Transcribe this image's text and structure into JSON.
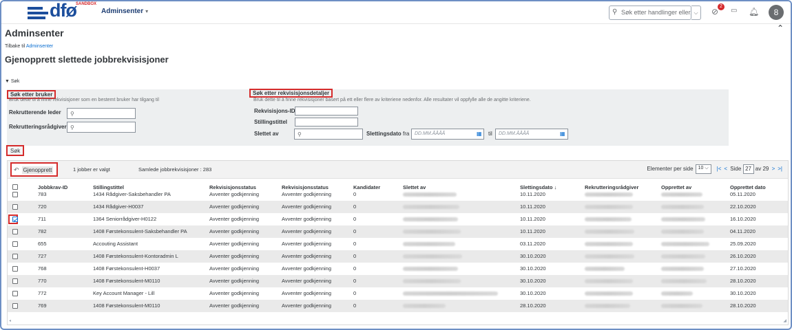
{
  "shell": {
    "logo_text": "dfø",
    "logo_badge": "SANDBOX",
    "menu_label": "Adminsenter",
    "search_placeholder": "Søk etter handlinger eller...",
    "notification_count": "2",
    "avatar_initial": "8"
  },
  "header": {
    "title": "Adminsenter",
    "back_prefix": "Tilbake til ",
    "back_link": "Adminsenter",
    "page_title": "Gjenopprett slettede jobbrekvisisjoner"
  },
  "search": {
    "toggle_label": "▼ Søk",
    "user_section": {
      "title": "Søk etter bruker",
      "description": "Bruk dette til å finne rekvisisjoner som en bestemt bruker har tilgang til",
      "fields": [
        "Rekrutterende leder",
        "Rekrutteringsrådgiver"
      ]
    },
    "details_section": {
      "title": "Søk etter rekvisisjonsdetaljer",
      "description": "Bruk dette til å finne rekvisisjoner basert på ett eller flere av kriteriene nedenfor. Alle resultater vil oppfylle alle de angitte kriteriene.",
      "field_req_id": "Rekvisisjons-ID",
      "field_title": "Stillingstittel",
      "field_deleted_by": "Slettet av",
      "field_delete_date": "Slettingsdato",
      "from_label": "fra",
      "to_label": "til",
      "date_placeholder": "DD.MM.ÅÅÅÅ"
    },
    "button_label": "Søk"
  },
  "toolbar": {
    "restore_label": "Gjenopprett",
    "selected_text": "1 jobber er valgt",
    "total_text": "Samlede jobbrekvisisjoner : 283",
    "per_page_label": "Elementer per side",
    "per_page_value": "10",
    "page_label": "Side",
    "page_value": "27",
    "page_total": "av 29"
  },
  "table": {
    "headers": {
      "id": "Jobbkrav-ID",
      "title": "Stillingstittel",
      "status1": "Rekvisisjonsstatus",
      "status2": "Rekvisisjonsstatus",
      "candidates": "Kandidater",
      "deleted_by": "Slettet av",
      "delete_date": "Slettingsdato ↓",
      "recruiter": "Rekrutteringsrådgiver",
      "created_by": "Opprettet av",
      "created_date": "Opprettet dato"
    },
    "rows": [
      {
        "id": "783",
        "title": "1434 Rådgiver-Saksbehandler PA",
        "status1": "Avventer godkjenning",
        "status2": "Avventer godkjenning",
        "candidates": "0",
        "delete_date": "10.11.2020",
        "created_date": "05.11.2020",
        "checked": false
      },
      {
        "id": "720",
        "title": "1434 Rådgiver-H0037",
        "status1": "Avventer godkjenning",
        "status2": "Avventer godkjenning",
        "candidates": "0",
        "delete_date": "10.11.2020",
        "created_date": "22.10.2020",
        "checked": false
      },
      {
        "id": "711",
        "title": "1364 Seniorrådgiver-H0122",
        "status1": "Avventer godkjenning",
        "status2": "Avventer godkjenning",
        "candidates": "0",
        "delete_date": "10.11.2020",
        "created_date": "16.10.2020",
        "checked": true
      },
      {
        "id": "782",
        "title": "1408 Førstekonsulent-Saksbehandler PA",
        "status1": "Avventer godkjenning",
        "status2": "Avventer godkjenning",
        "candidates": "0",
        "delete_date": "10.11.2020",
        "created_date": "04.11.2020",
        "checked": false
      },
      {
        "id": "655",
        "title": "Accouting Assistant",
        "status1": "Avventer godkjenning",
        "status2": "Avventer godkjenning",
        "candidates": "0",
        "delete_date": "03.11.2020",
        "created_date": "25.09.2020",
        "checked": false
      },
      {
        "id": "727",
        "title": "1408 Førstekonsulent-Kontoradmin L",
        "status1": "Avventer godkjenning",
        "status2": "Avventer godkjenning",
        "candidates": "0",
        "delete_date": "30.10.2020",
        "created_date": "26.10.2020",
        "checked": false
      },
      {
        "id": "768",
        "title": "1408 Førstekonsulent-H0037",
        "status1": "Avventer godkjenning",
        "status2": "Avventer godkjenning",
        "candidates": "0",
        "delete_date": "30.10.2020",
        "created_date": "27.10.2020",
        "checked": false
      },
      {
        "id": "770",
        "title": "1408 Førstekonsulent-M0110",
        "status1": "Avventer godkjenning",
        "status2": "Avventer godkjenning",
        "candidates": "0",
        "delete_date": "30.10.2020",
        "created_date": "28.10.2020",
        "checked": false
      },
      {
        "id": "772",
        "title": "Key Account Manager - Lill",
        "status1": "Avventer godkjenning",
        "status2": "Avventer godkjenning",
        "candidates": "0",
        "delete_date": "30.10.2020",
        "created_date": "30.10.2020",
        "checked": false
      },
      {
        "id": "769",
        "title": "1408 Førstekonsulent-M0110",
        "status1": "Avventer godkjenning",
        "status2": "Avventer godkjenning",
        "candidates": "0",
        "delete_date": "28.10.2020",
        "created_date": "28.10.2020",
        "checked": false
      }
    ]
  },
  "colors": {
    "brand": "#1c4e9c",
    "highlight_red": "#d52b2b",
    "link": "#0a6ed1"
  }
}
